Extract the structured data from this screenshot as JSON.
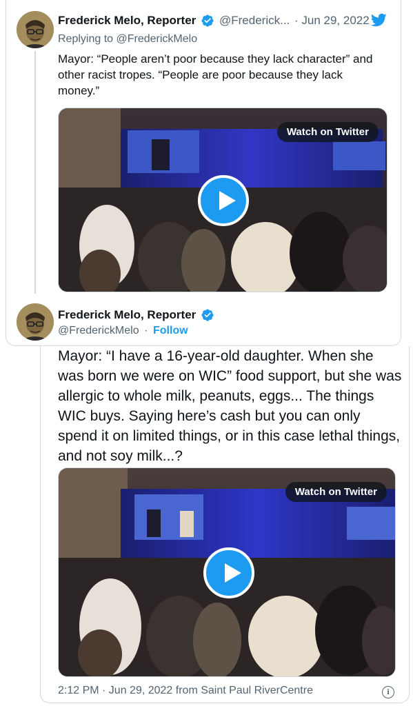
{
  "tweet1": {
    "name": "Frederick Melo, Reporter",
    "handle": "@Frederick...",
    "date": "· Jun 29, 2022",
    "replying_prefix": "Replying to",
    "replying_to": "@FrederickMelo",
    "text": "Mayor: “People aren’t poor because they lack character” and other racist tropes. “People are poor because they lack money.”",
    "media": {
      "watch_label": "Watch on Twitter"
    }
  },
  "tweet2": {
    "name": "Frederick Melo, Reporter",
    "handle": "@FrederickMelo",
    "separator": "·",
    "follow_label": "Follow",
    "text": "Mayor: “I have a 16-year-old daughter. When she was born we were on WIC” food support, but she was allergic to whole milk, peanuts, eggs... The things WIC buys. Saying here’s cash but you can only spend it on limited things, or in this case lethal things, and not soy milk...?",
    "media": {
      "watch_label": "Watch on Twitter"
    },
    "timestamp": "2:12 PM · Jun 29, 2022 from Saint Paul RiverCentre",
    "info_glyph": "i"
  },
  "colors": {
    "accent": "#1d9bf0",
    "text": "#0f1419",
    "muted": "#536471",
    "border": "#cfd9de"
  }
}
